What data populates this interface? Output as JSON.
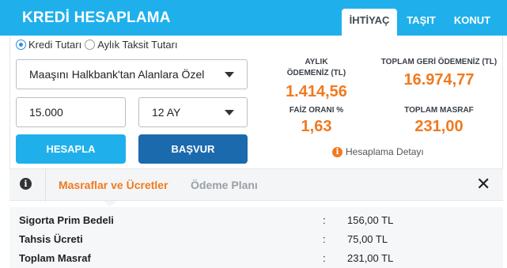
{
  "header": {
    "title": "KREDİ HESAPLAMA",
    "tabs": [
      {
        "label": "İHTİYAÇ",
        "active": true
      },
      {
        "label": "TAŞIT",
        "active": false
      },
      {
        "label": "KONUT",
        "active": false
      }
    ]
  },
  "form": {
    "radio_options": [
      {
        "label": "Kredi Tutarı",
        "checked": true
      },
      {
        "label": "Aylık Taksit Tutarı",
        "checked": false
      }
    ],
    "campaign_select": "Maaşını Halkbank'tan Alanlara Özel",
    "amount_value": "15.000",
    "term_select": "12 AY",
    "calculate_button": "HESAPLA",
    "apply_button": "BAŞVUR"
  },
  "results": {
    "monthly_label_1": "AYLIK",
    "monthly_label_2": "ÖDEMENİZ (TL)",
    "monthly_value": "1.414,56",
    "total_label": "TOPLAM GERİ ÖDEMENİZ (TL)",
    "total_value": "16.974,77",
    "rate_label": "FAİZ ORANI %",
    "rate_value": "1,63",
    "cost_label": "TOPLAM MASRAF",
    "cost_value": "231,00",
    "detail_link": "Hesaplama Detayı"
  },
  "details": {
    "tabs": [
      {
        "label": "Masraflar ve Ücretler",
        "active": true
      },
      {
        "label": "Ödeme Planı",
        "active": false
      }
    ],
    "rows": [
      {
        "label": "Sigorta Prim Bedeli",
        "sep": ":",
        "value": "156,00 TL"
      },
      {
        "label": "Tahsis Ücreti",
        "sep": ":",
        "value": "75,00 TL"
      },
      {
        "label": "Toplam Masraf",
        "sep": ":",
        "value": "231,00 TL"
      }
    ]
  },
  "colors": {
    "brand_blue": "#1fb0ec",
    "dark_blue": "#1b6aae",
    "accent_orange": "#f07a1f"
  }
}
